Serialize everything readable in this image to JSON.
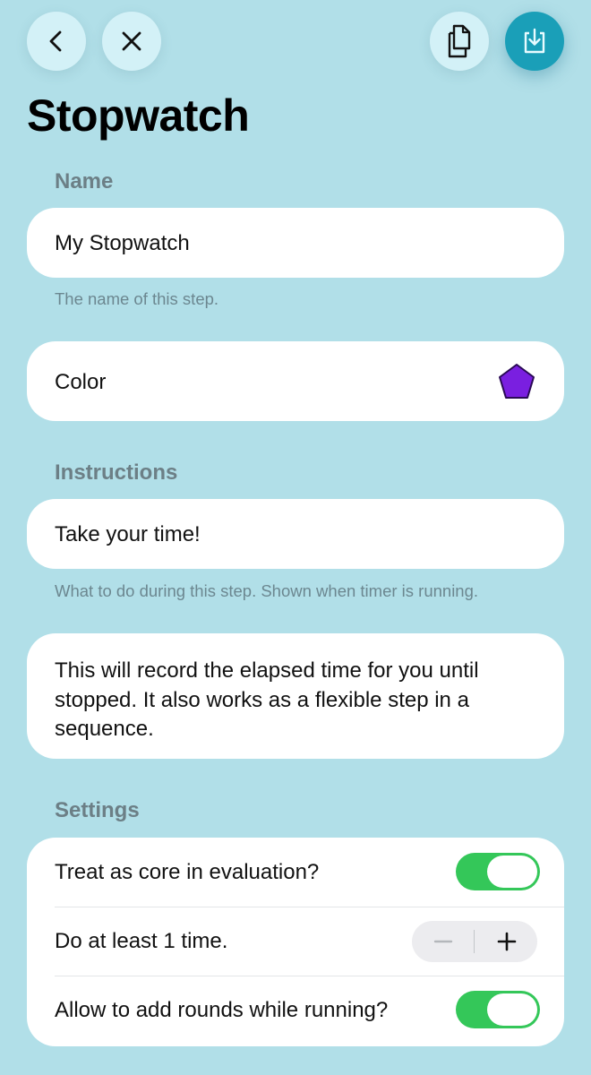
{
  "header": {
    "title": "Stopwatch",
    "icons": {
      "back": "chevron-left-icon",
      "close": "close-icon",
      "copy": "copy-icon",
      "save": "download-tray-icon"
    }
  },
  "name_section": {
    "label": "Name",
    "value": "My Stopwatch",
    "hint": "The name of this step."
  },
  "color_section": {
    "label": "Color",
    "swatch_color": "#7a1fe0"
  },
  "instructions_section": {
    "label": "Instructions",
    "value": "Take your time!",
    "hint": "What to do during this step. Shown when timer is running."
  },
  "description": "This will record the elapsed time for you until stopped. It also works as a flexible step in a sequence.",
  "settings": {
    "label": "Settings",
    "core_label": "Treat as core in evaluation?",
    "core_on": true,
    "repeat_label": "Do at least 1 time.",
    "rounds_label": "Allow to add rounds while running?",
    "rounds_on": true
  },
  "colors": {
    "background": "#b1dfe8",
    "accent": "#1a9fb8",
    "toggle_on": "#34c759"
  }
}
